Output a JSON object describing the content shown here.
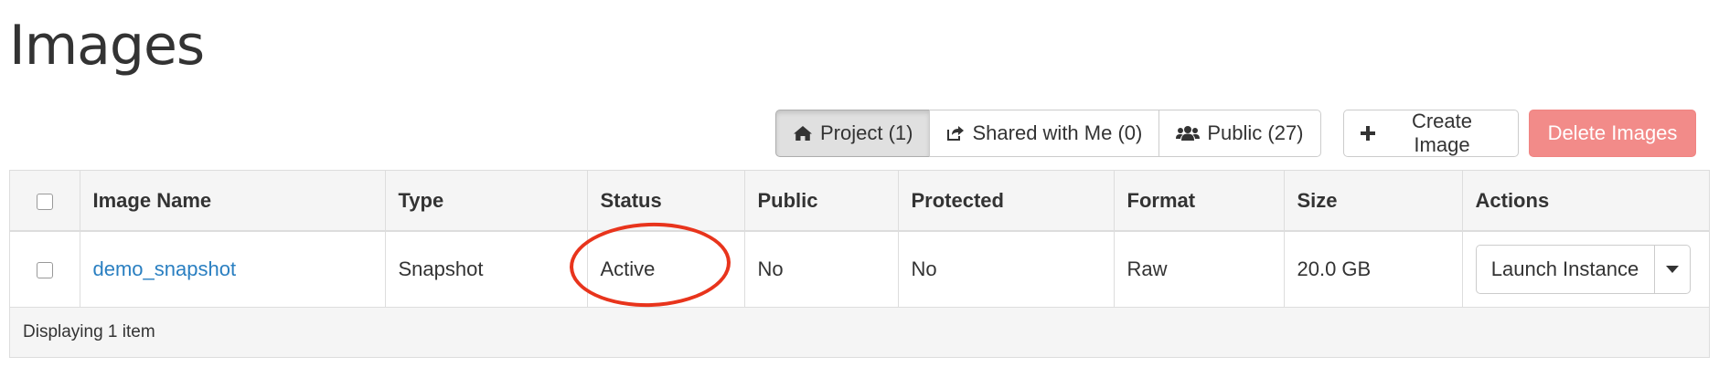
{
  "page": {
    "title": "Images"
  },
  "filters": {
    "project_label": "Project (1)",
    "shared_label": "Shared with Me (0)",
    "public_label": "Public (27)"
  },
  "toolbar": {
    "create_label": "Create Image",
    "delete_label": "Delete Images"
  },
  "table": {
    "columns": [
      "Image Name",
      "Type",
      "Status",
      "Public",
      "Protected",
      "Format",
      "Size",
      "Actions"
    ],
    "rows": [
      {
        "name": "demo_snapshot",
        "type": "Snapshot",
        "status": "Active",
        "public": "No",
        "protected": "No",
        "format": "Raw",
        "size": "20.0 GB",
        "action_label": "Launch Instance"
      }
    ],
    "footer": "Displaying 1 item"
  },
  "icons": {
    "project": "home-icon",
    "shared": "share-icon",
    "public": "users-icon",
    "create": "plus-icon",
    "caret": "caret-down-icon"
  },
  "colors": {
    "link": "#2a7fc1",
    "danger": "#f28b89",
    "annotation": "#e8341c"
  }
}
